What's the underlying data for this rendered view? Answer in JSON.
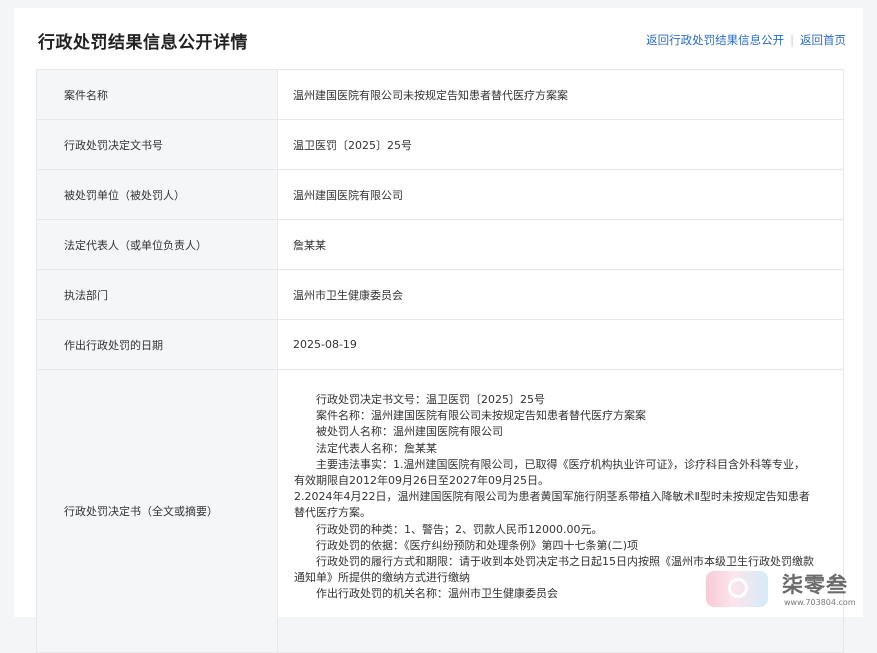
{
  "page": {
    "title": "行政处罚结果信息公开详情",
    "links": {
      "back_to_list": "返回行政处罚结果信息公开",
      "back_home": "返回首页"
    }
  },
  "table": {
    "rows": [
      {
        "label": "案件名称",
        "value": "温州建国医院有限公司未按规定告知患者替代医疗方案案"
      },
      {
        "label": "行政处罚决定文书号",
        "value": "温卫医罚〔2025〕25号"
      },
      {
        "label": "被处罚单位（被处罚人）",
        "value": "温州建国医院有限公司"
      },
      {
        "label": "法定代表人（或单位负责人）",
        "value": "詹某某"
      },
      {
        "label": "执法部门",
        "value": "温州市卫生健康委员会"
      },
      {
        "label": "作出行政处罚的日期",
        "value": "2025-08-19"
      }
    ],
    "decision": {
      "label": "行政处罚决定书（全文或摘要）",
      "lines": [
        "行政处罚决定书文号：温卫医罚〔2025〕25号",
        "案件名称：温州建国医院有限公司未按规定告知患者替代医疗方案案",
        "被处罚人名称：温州建国医院有限公司",
        "法定代表人名称：詹某某",
        "主要违法事实：1.温州建国医院有限公司，已取得《医疗机构执业许可证》，诊疗科目含外科等专业，",
        "有效期限自2012年09月26日至2027年09月25日。",
        "2.2024年4月22日，温州建国医院有限公司为患者黄国军施行阴茎系带植入降敏术Ⅱ型时未按规定告知患者",
        "替代医疗方案。",
        "行政处罚的种类：1、警告；2、罚款人民币12000.00元。",
        "行政处罚的依据：《医疗纠纷预防和处理条例》第四十七条第(二)项",
        "行政处罚的履行方式和期限：请于收到本处罚决定书之日起15日内按照《温州市本级卫生行政处罚缴款",
        "通知单》所提供的缴纳方式进行缴纳",
        "作出行政处罚的机关名称：温州市卫生健康委员会"
      ]
    }
  },
  "watermark": {
    "brand": "柒零叁",
    "url": "www.703804.com"
  }
}
